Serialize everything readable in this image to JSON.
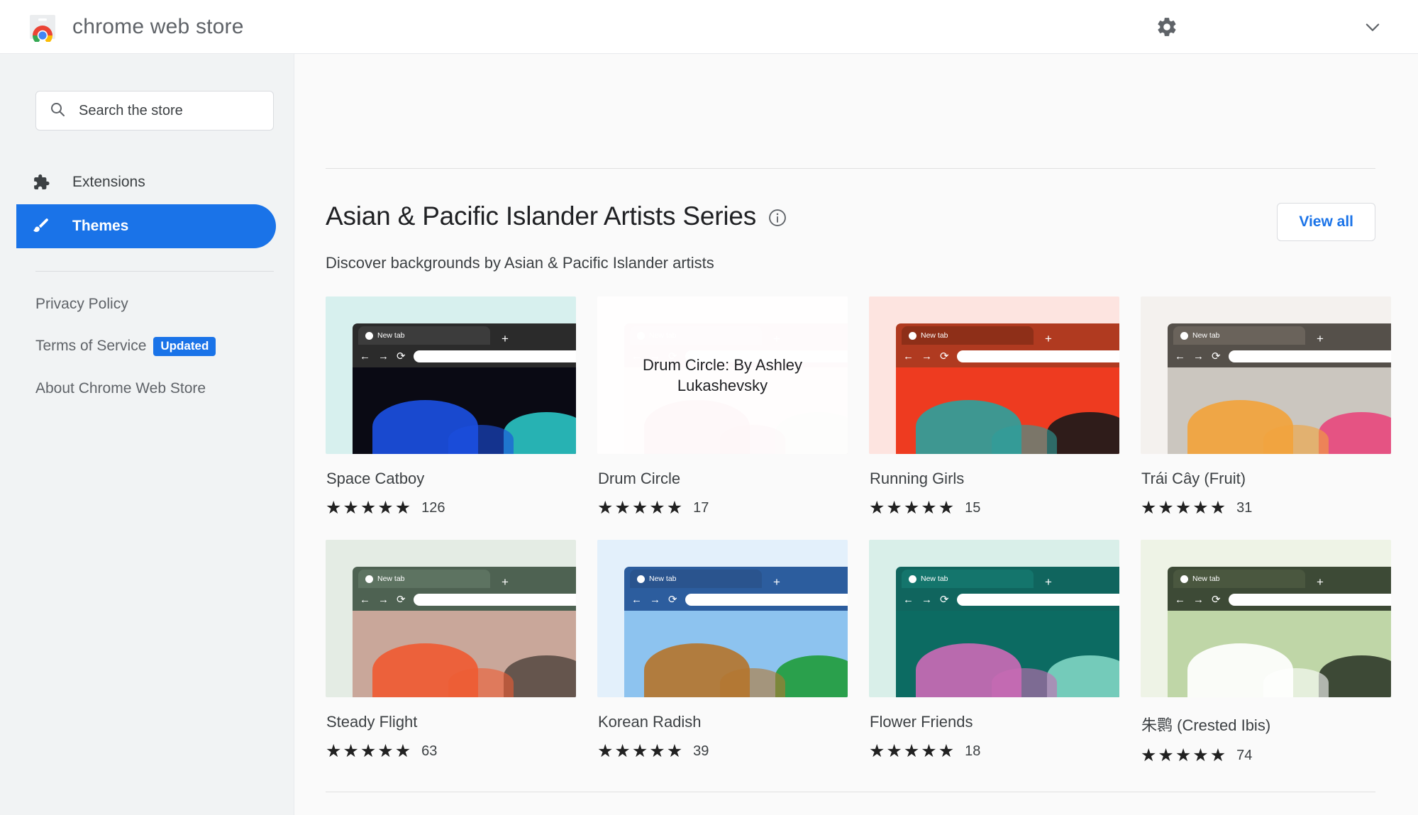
{
  "header": {
    "logo_icon": "chrome-web-store-logo",
    "title": "chrome web store",
    "settings_icon": "gear-icon",
    "expand_icon": "chevron-down-icon"
  },
  "sidebar": {
    "search": {
      "icon": "search-icon",
      "placeholder": "Search the store",
      "value": ""
    },
    "nav_items": [
      {
        "label": "Extensions",
        "icon": "puzzle-piece-icon",
        "active": false
      },
      {
        "label": "Themes",
        "icon": "paintbrush-icon",
        "active": true
      }
    ],
    "links": [
      {
        "label": "Privacy Policy",
        "badge": ""
      },
      {
        "label": "Terms of Service",
        "badge": "Updated"
      },
      {
        "label": "About Chrome Web Store",
        "badge": ""
      }
    ]
  },
  "main": {
    "section_title": "Asian & Pacific Islander Artists Series",
    "info_icon": "info-icon",
    "view_all_label": "View all",
    "subtitle": "Discover backgrounds by Asian & Pacific Islander artists",
    "cards": [
      {
        "title": "Space Catboy",
        "stars": 5,
        "rating_count": "126",
        "preview": {
          "tab_label": "New tab",
          "plus_label": "+",
          "frame_color": "#2b2b2b",
          "tab_color": "#3c3c3c",
          "page_color": "#0a0a14",
          "card_bg": "#d7f0ee",
          "accent_a": "#1b4fe0",
          "accent_b": "#2ac4c4",
          "caption": ""
        }
      },
      {
        "title": "Drum Circle",
        "stars": 5,
        "rating_count": "17",
        "preview": {
          "tab_label": "New tab",
          "plus_label": "+",
          "frame_color": "#f5d4d8",
          "tab_color": "#f7dde0",
          "page_color": "#fbe9ea",
          "card_bg": "#fdf3f4",
          "accent_a": "#f0bcc4",
          "accent_b": "#e7f0e4",
          "caption": "Drum Circle: By Ashley Lukashevsky"
        }
      },
      {
        "title": "Running Girls",
        "stars": 5,
        "rating_count": "15",
        "preview": {
          "tab_label": "New tab",
          "plus_label": "+",
          "frame_color": "#b03a20",
          "tab_color": "#8e2f18",
          "page_color": "#ee3b20",
          "card_bg": "#fde4e0",
          "accent_a": "#2f9f9b",
          "accent_b": "#1a1a1a",
          "caption": ""
        }
      },
      {
        "title": "Trái Cây (Fruit)",
        "stars": 5,
        "rating_count": "31",
        "preview": {
          "tab_label": "New tab",
          "plus_label": "+",
          "frame_color": "#55504a",
          "tab_color": "#6a635b",
          "page_color": "#cbc6bf",
          "card_bg": "#f4f1ee",
          "accent_a": "#f2a33c",
          "accent_b": "#e8467c",
          "caption": ""
        }
      },
      {
        "title": "Steady Flight",
        "stars": 5,
        "rating_count": "63",
        "preview": {
          "tab_label": "New tab",
          "plus_label": "+",
          "frame_color": "#4e6252",
          "tab_color": "#5d7361",
          "page_color": "#c9a79a",
          "card_bg": "#e4ece4",
          "accent_a": "#ef5b33",
          "accent_b": "#5a4c45",
          "caption": ""
        }
      },
      {
        "title": "Korean Radish",
        "stars": 5,
        "rating_count": "39",
        "preview": {
          "tab_label": "New tab",
          "plus_label": "+",
          "frame_color": "#2c5d9e",
          "tab_color": "#2a548e",
          "page_color": "#8dc3ef",
          "card_bg": "#e3f0fb",
          "accent_a": "#b4762f",
          "accent_b": "#1f9c3a",
          "caption": ""
        }
      },
      {
        "title": "Flower Friends",
        "stars": 5,
        "rating_count": "18",
        "preview": {
          "tab_label": "New tab",
          "plus_label": "+",
          "frame_color": "#10655e",
          "tab_color": "#14756c",
          "page_color": "#0c6b62",
          "card_bg": "#d9efe9",
          "accent_a": "#c96ab4",
          "accent_b": "#7fd6c4",
          "caption": ""
        }
      },
      {
        "title": "朱鹮 (Crested Ibis)",
        "stars": 5,
        "rating_count": "74",
        "preview": {
          "tab_label": "New tab",
          "plus_label": "+",
          "frame_color": "#3d4a36",
          "tab_color": "#4a573f",
          "page_color": "#bfd6a7",
          "card_bg": "#eef3e6",
          "accent_a": "#ffffff",
          "accent_b": "#2f3a2a",
          "caption": ""
        }
      }
    ]
  }
}
